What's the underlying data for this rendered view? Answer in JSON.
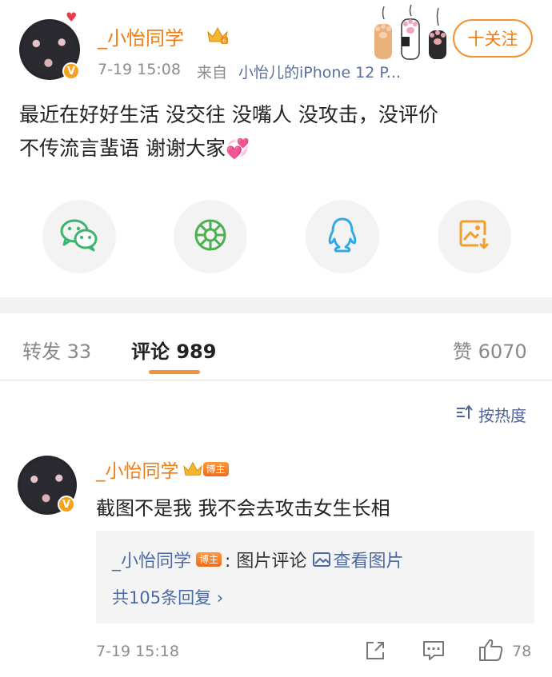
{
  "post": {
    "author": "_小怡同学",
    "time": "7-19 15:08",
    "source_prefix": "来自",
    "source": "小怡儿的iPhone 12 P...",
    "follow_label": "十关注",
    "content_line1": "最近在好好生活 没交往 没嘴人 没攻击，没评价",
    "content_line2": "不传流言蜚语 谢谢大家",
    "emoji": "💞"
  },
  "share": {
    "items": [
      {
        "icon": "wechat-icon",
        "color": "#3cb371"
      },
      {
        "icon": "moments-icon",
        "color": "#4cb050"
      },
      {
        "icon": "qq-icon",
        "color": "#33a8e6"
      },
      {
        "icon": "save-image-icon",
        "color": "#f2a02a"
      }
    ]
  },
  "tabs": {
    "repost": "转发 33",
    "comment": "评论 989",
    "like": "赞 6070"
  },
  "sort": {
    "label": "按热度"
  },
  "comment": {
    "author": "_小怡同学",
    "badge": "博主",
    "text": "截图不是我 我不会去攻击女生长相",
    "reply_author": "_小怡同学",
    "reply_badge": "博主",
    "reply_text": ": 图片评论",
    "view_image": "查看图片",
    "reply_count": "共105条回复 ›",
    "time": "7-19 15:18",
    "likes": "78"
  },
  "colors": {
    "accent": "#f07c13",
    "link": "#5a6f9b",
    "tab_underline": "#f29333"
  }
}
